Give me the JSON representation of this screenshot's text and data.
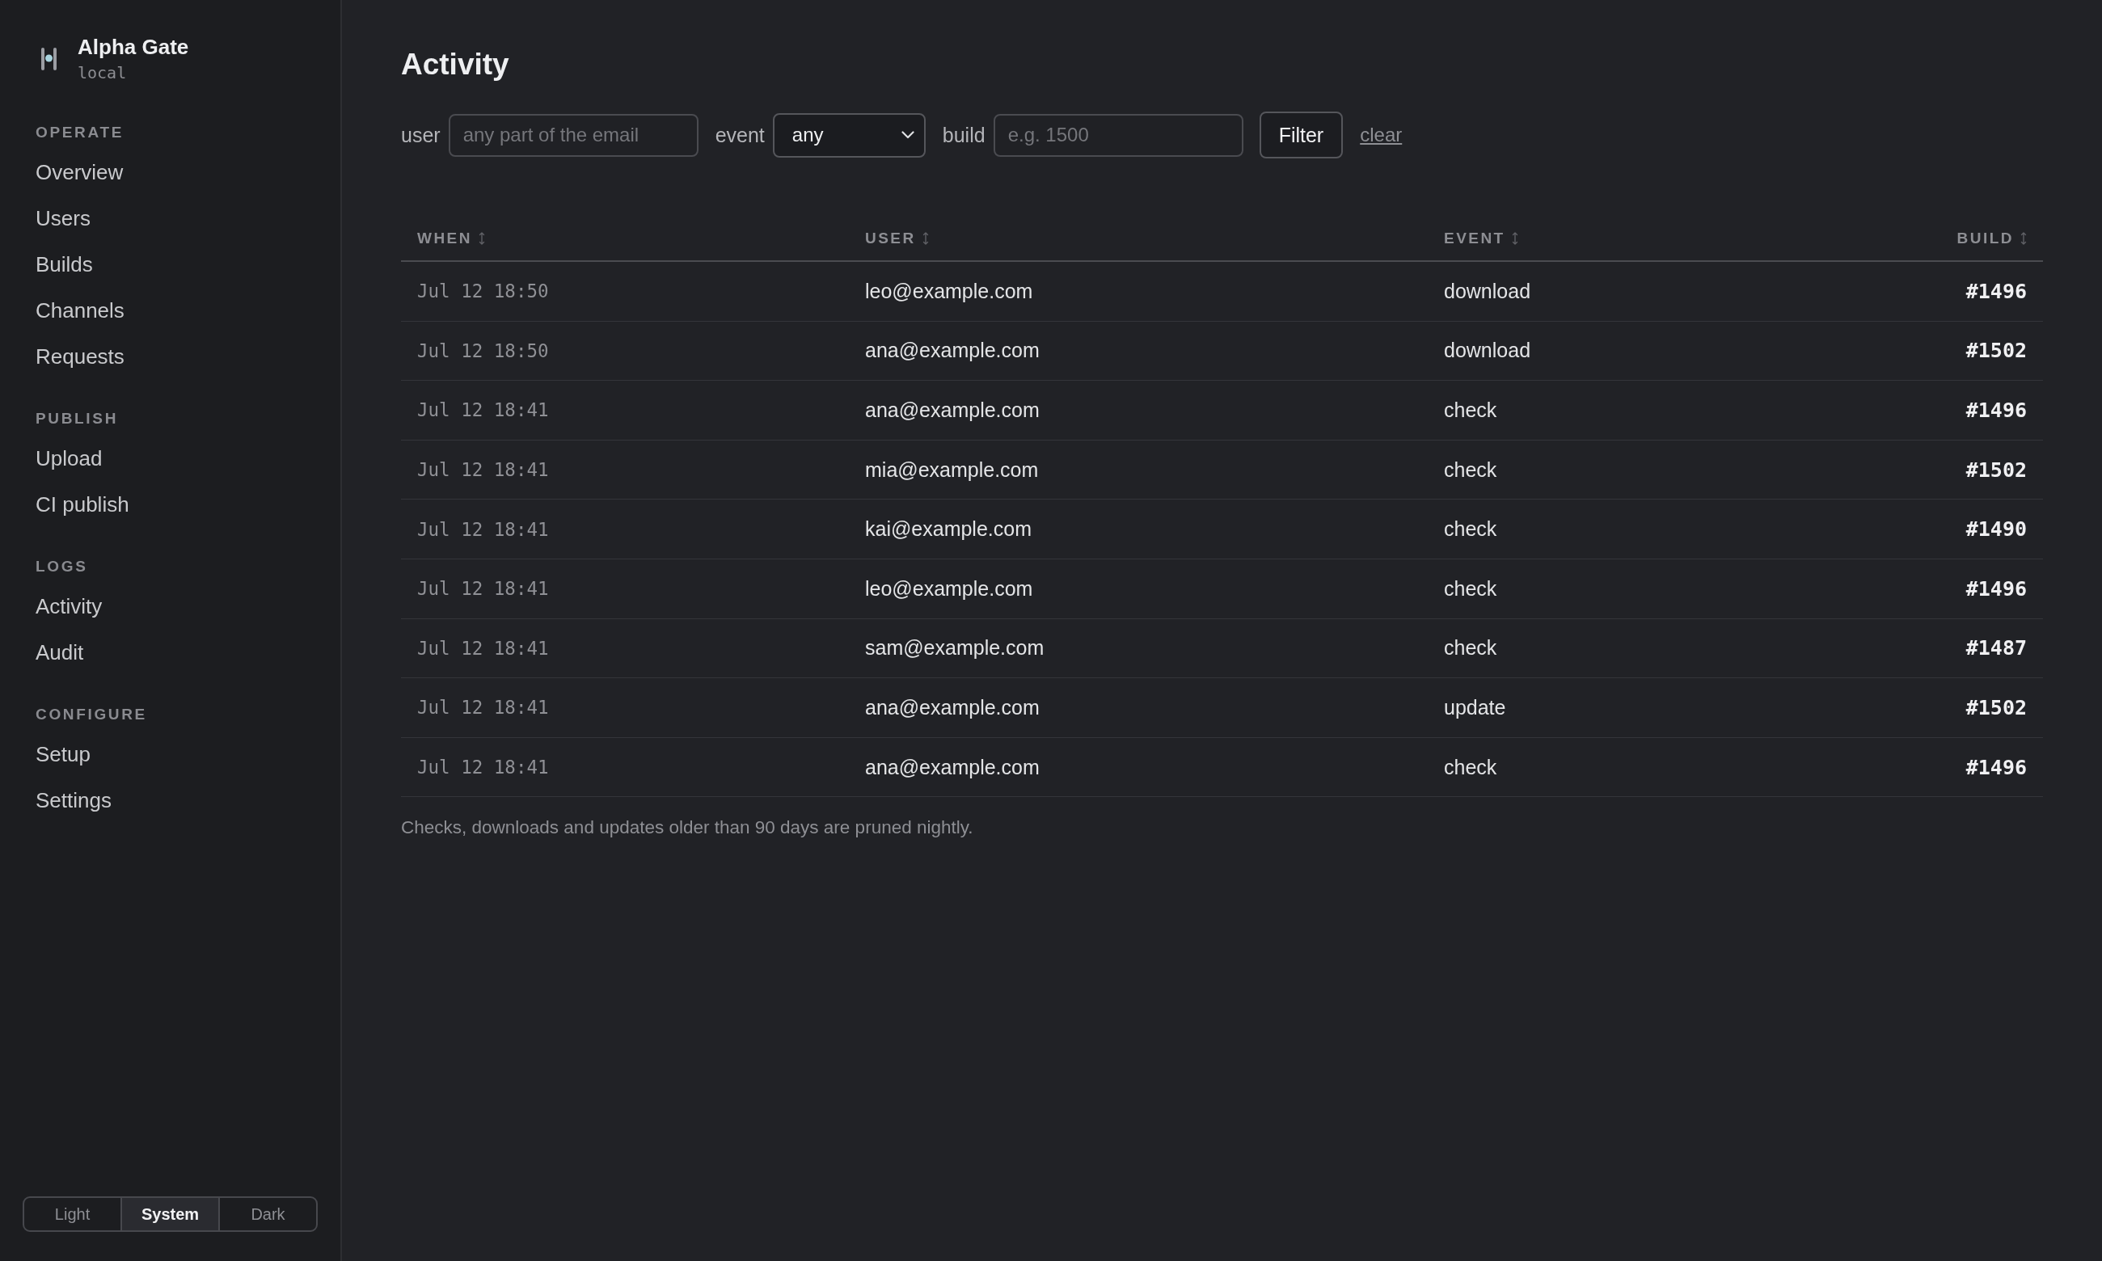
{
  "brand": {
    "name": "Alpha Gate",
    "environment": "local"
  },
  "sidebar": {
    "sections": [
      {
        "heading": "OPERATE",
        "items": [
          "Overview",
          "Users",
          "Builds",
          "Channels",
          "Requests"
        ]
      },
      {
        "heading": "PUBLISH",
        "items": [
          "Upload",
          "CI publish"
        ]
      },
      {
        "heading": "LOGS",
        "items": [
          "Activity",
          "Audit"
        ]
      },
      {
        "heading": "CONFIGURE",
        "items": [
          "Setup",
          "Settings"
        ]
      }
    ]
  },
  "theme_switcher": {
    "options": [
      {
        "label": "Light",
        "selected": false
      },
      {
        "label": "System",
        "selected": true
      },
      {
        "label": "Dark",
        "selected": false
      }
    ]
  },
  "page": {
    "title": "Activity"
  },
  "filters": {
    "user": {
      "label": "user",
      "placeholder": "any part of the email"
    },
    "event": {
      "label": "event",
      "value": "any"
    },
    "build": {
      "label": "build",
      "placeholder": "e.g. 1500"
    },
    "submit": "Filter",
    "clear": "clear"
  },
  "table": {
    "columns": [
      {
        "label": "WHEN",
        "kind": "time"
      },
      {
        "label": "USER",
        "kind": "text"
      },
      {
        "label": "EVENT",
        "kind": "text"
      },
      {
        "label": "BUILD",
        "kind": "number"
      }
    ],
    "rows": [
      [
        "Jul 12 18:50",
        "leo@example.com",
        "download",
        "#1496"
      ],
      [
        "Jul 12 18:50",
        "ana@example.com",
        "download",
        "#1502"
      ],
      [
        "Jul 12 18:41",
        "ana@example.com",
        "check",
        "#1496"
      ],
      [
        "Jul 12 18:41",
        "mia@example.com",
        "check",
        "#1502"
      ],
      [
        "Jul 12 18:41",
        "kai@example.com",
        "check",
        "#1490"
      ],
      [
        "Jul 12 18:41",
        "leo@example.com",
        "check",
        "#1496"
      ],
      [
        "Jul 12 18:41",
        "sam@example.com",
        "check",
        "#1487"
      ],
      [
        "Jul 12 18:41",
        "ana@example.com",
        "update",
        "#1502"
      ],
      [
        "Jul 12 18:41",
        "ana@example.com",
        "check",
        "#1496"
      ]
    ],
    "note": "Checks, downloads and updates older than 90 days are pruned nightly."
  }
}
